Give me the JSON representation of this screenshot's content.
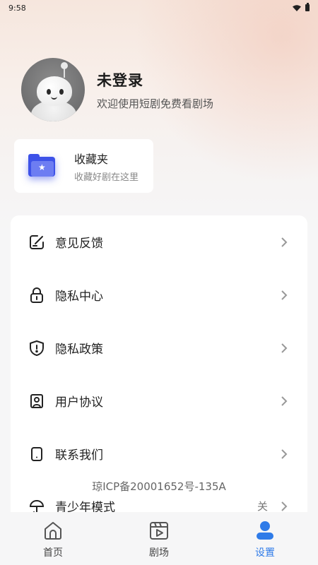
{
  "status_bar": {
    "time": "9:58"
  },
  "profile": {
    "name": "未登录",
    "subtitle": "欢迎使用短剧免费看剧场"
  },
  "favorites": {
    "title": "收藏夹",
    "subtitle": "收藏好剧在这里",
    "icon": "folder-star-icon"
  },
  "menu": {
    "items": [
      {
        "label": "意见反馈",
        "icon": "feedback-icon"
      },
      {
        "label": "隐私中心",
        "icon": "lock-icon"
      },
      {
        "label": "隐私政策",
        "icon": "shield-icon"
      },
      {
        "label": "用户协议",
        "icon": "user-agreement-icon"
      },
      {
        "label": "联系我们",
        "icon": "phone-icon"
      },
      {
        "label": "青少年模式",
        "icon": "umbrella-icon",
        "value": "关"
      }
    ],
    "icp": "琼ICP备20001652号-135A"
  },
  "tabbar": {
    "tabs": [
      {
        "label": "首页",
        "icon": "home-icon",
        "active": false
      },
      {
        "label": "剧场",
        "icon": "theater-icon",
        "active": false
      },
      {
        "label": "设置",
        "icon": "user-icon",
        "active": true
      }
    ]
  },
  "colors": {
    "accent": "#2f7be8",
    "folder": "#3d52e8"
  }
}
